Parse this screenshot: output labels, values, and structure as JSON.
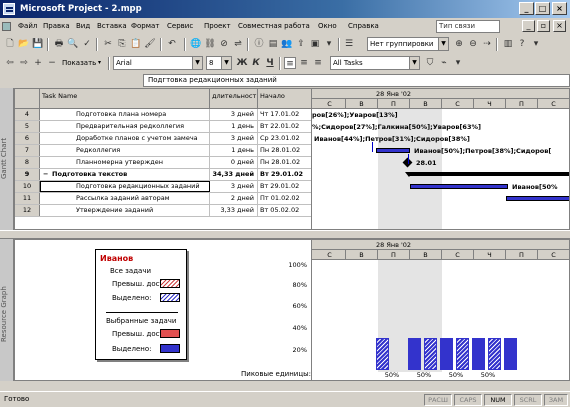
{
  "window": {
    "title": "Microsoft Project - 2.mpp"
  },
  "menu": [
    "Файл",
    "Правка",
    "Вид",
    "Вставка",
    "Формат",
    "Сервис",
    "Проект",
    "Совместная работа",
    "Окно",
    "Справка"
  ],
  "help_box": "Тип связи",
  "toolbar1": {
    "grouping": "Нет группировки"
  },
  "toolbar2": {
    "show": "Показать",
    "font": "Arial",
    "size": "8",
    "bold": "Ж",
    "italic": "К",
    "underline": "Ч",
    "filter": "All Tasks"
  },
  "entry_bar": {
    "value": "Подгтовка редакционных заданий"
  },
  "views": {
    "upper": "Gantt Chart",
    "lower": "Resource Graph"
  },
  "grid": {
    "columns": {
      "name": "Task Name",
      "duration": "длительност",
      "start": "Начало"
    },
    "rows": [
      {
        "id": "4",
        "name": "Подготовка плана номера",
        "duration": "3 дней",
        "start": "Чт 17.01.02",
        "level": 2,
        "summary": false
      },
      {
        "id": "5",
        "name": "Предварительная редколлегия",
        "duration": "1 день",
        "start": "Вт 22.01.02",
        "level": 2,
        "summary": false
      },
      {
        "id": "6",
        "name": "Доработке планов с учетом замеча",
        "duration": "3 дней",
        "start": "Ср 23.01.02",
        "level": 2,
        "summary": false
      },
      {
        "id": "7",
        "name": "Редколлегия",
        "duration": "1 день",
        "start": "Пн 28.01.02",
        "level": 2,
        "summary": false
      },
      {
        "id": "8",
        "name": "Планномерна утвержден",
        "duration": "0 дней",
        "start": "Пн 28.01.02",
        "level": 2,
        "summary": false
      },
      {
        "id": "9",
        "name": "Подготовка текстов",
        "duration": "34,33 дней",
        "start": "Вт 29.01.02",
        "level": 1,
        "summary": true
      },
      {
        "id": "10",
        "name": "Подготовка редакционных заданий",
        "duration": "3 дней",
        "start": "Вт 29.01.02",
        "level": 2,
        "summary": false
      },
      {
        "id": "11",
        "name": "Рассылка заданий авторам",
        "duration": "2 дней",
        "start": "Пт 01.02.02",
        "level": 2,
        "summary": false
      },
      {
        "id": "12",
        "name": "Утверждение заданий",
        "duration": "3,33 дней",
        "start": "Вт 05.02.02",
        "level": 2,
        "summary": false
      }
    ]
  },
  "gantt": {
    "week": "28 Янв '02",
    "days": [
      "С",
      "В",
      "П",
      "В",
      "С",
      "Ч",
      "П",
      "С"
    ],
    "labels": {
      "r4": "ров[26%];Уваров[13%]",
      "r5": "%;Сидоров[27%];Галкина[50%];Уваров[63%]",
      "r6": "Иванов[44%];Петров[31%];Сидоров[38%]",
      "r7": "Иванов[50%];Петров[38%];Сидоров[",
      "r8": "28.01",
      "r10": "Иванов[50%"
    }
  },
  "resource": {
    "name": "Иванов",
    "all_tasks": "Все задачи",
    "overalloc": "Превыш. дост.:",
    "allocated": "Выделено:",
    "selected_tasks": "Выбранные задачи",
    "overalloc2": "Превыш. дост.:",
    "allocated2": "Выделено:",
    "peak": "Пиковые единицы:",
    "axis": [
      "100%",
      "80%",
      "60%",
      "40%",
      "20%"
    ],
    "peak_values": [
      "50%",
      "50%",
      "50%",
      "50%"
    ],
    "bars": [
      50,
      50,
      50,
      50,
      50,
      50,
      50,
      50
    ]
  },
  "status": {
    "left": "Готово",
    "indicators": [
      "РАСШ",
      "CAPS",
      "NUM",
      "SCRL",
      "ЗАМ"
    ]
  }
}
